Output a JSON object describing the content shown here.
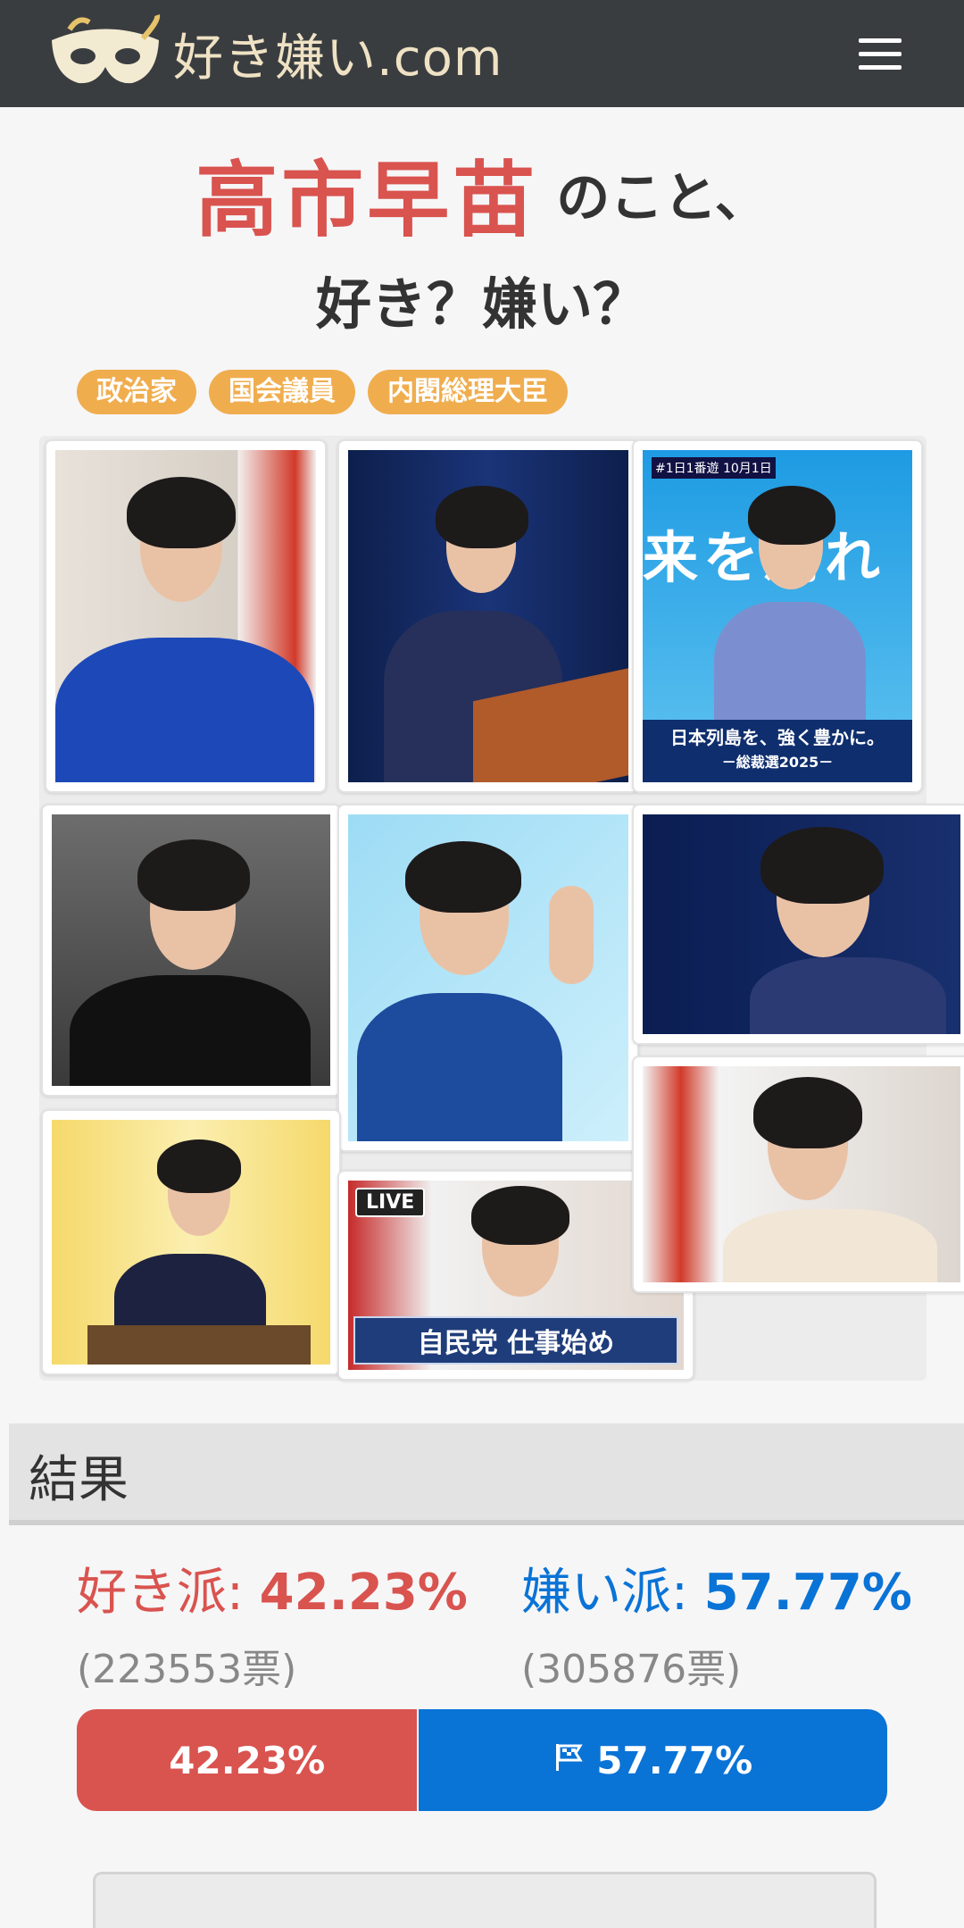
{
  "header": {
    "logo_text": "好き嫌い.com",
    "menu_icon": "hamburger-icon"
  },
  "title": {
    "name": "高市早苗",
    "suffix": "のこと、",
    "question": "好き？嫌い？"
  },
  "tags": [
    "政治家",
    "国会議員",
    "内閣総理大臣"
  ],
  "gallery": {
    "poster_top": "#1日1番遊 10月1日",
    "poster_big": "来を創れ",
    "poster_bottom_1": "日本列島を、強く豊かに。",
    "poster_bottom_2": "－総裁選2025－",
    "live_label": "LIVE",
    "news_caption": "自民党 仕事始め"
  },
  "results": {
    "heading": "結果",
    "like_label": "好き派: ",
    "like_pct": "42.23%",
    "like_votes": "(223553票)",
    "dislike_label": "嫌い派: ",
    "dislike_pct": "57.77%",
    "dislike_votes": "(305876票)",
    "bar_like_text": "42.23%",
    "bar_dislike_text": "57.77%",
    "like_fraction": 0.4223,
    "colors": {
      "like": "#d9534f",
      "dislike": "#0a73d6",
      "tag": "#f0ad4e"
    }
  }
}
